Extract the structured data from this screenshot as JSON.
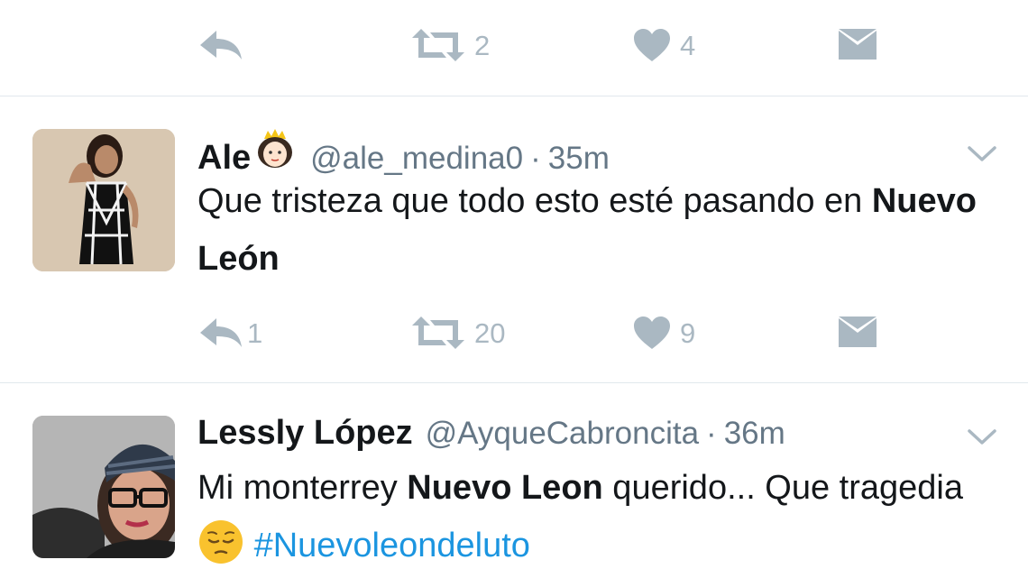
{
  "top_actions": {
    "reply_count": "",
    "retweet_count": "2",
    "like_count": "4"
  },
  "tweets": [
    {
      "name": "Ale",
      "name_emoji": "princess-emoji-icon",
      "handle": "@ale_medina0",
      "separator": "·",
      "time": "35m",
      "text_segments": [
        {
          "text": "Que tristeza que todo esto esté pasando en ",
          "bold": false
        },
        {
          "text": "Nuevo León",
          "bold": true
        }
      ],
      "reply_count": "1",
      "retweet_count": "20",
      "like_count": "9"
    },
    {
      "name": "Lessly López",
      "handle": "@AyqueCabroncita",
      "separator": "·",
      "time": "36m",
      "text_parts": {
        "p1": "Mi monterrey ",
        "p2": "Nuevo Leon",
        "p3": " querido... Que tragedia ",
        "emoji": "pensive-face-emoji-icon",
        "hashtag": "#Nuevoleondeluto"
      }
    }
  ],
  "colors": {
    "icon_gray": "#aab8c2",
    "text_primary": "#14171a",
    "text_secondary": "#657786",
    "hashtag": "#1b95e0",
    "divider": "#e1e8ed"
  }
}
